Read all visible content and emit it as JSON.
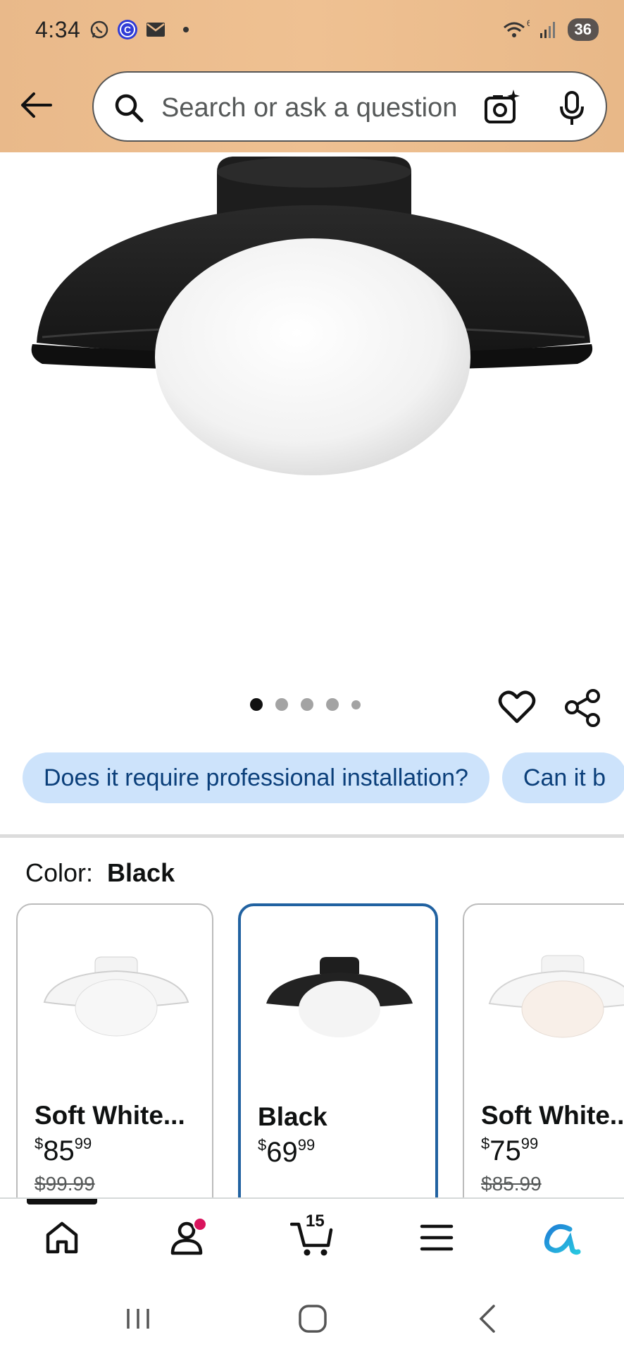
{
  "status_bar": {
    "time": "4:34",
    "wifi_label": "6",
    "battery": "36",
    "icons": [
      "whatsapp-icon",
      "c-app-icon",
      "mail-icon",
      "dot-icon",
      "wifi-icon",
      "signal-icon",
      "battery-icon"
    ]
  },
  "header": {
    "back_icon": "arrow-left-icon",
    "search_placeholder": "Search or ask a question",
    "camera_icon": "camera-sparkle-icon",
    "mic_icon": "microphone-icon",
    "accent_color": "#efc192"
  },
  "gallery": {
    "image_count": 5,
    "active_index": 0,
    "heart_icon": "heart-icon",
    "share_icon": "share-icon"
  },
  "questions": [
    "Does it require professional installation?",
    "Can it b"
  ],
  "color_selector": {
    "label": "Color:",
    "selected": "Black",
    "options": [
      {
        "name": "Soft White...",
        "price_whole": "85",
        "price_fraction": "99",
        "currency": "$",
        "list_price": "$99.99",
        "selected": false
      },
      {
        "name": "Black",
        "price_whole": "69",
        "price_fraction": "99",
        "currency": "$",
        "list_price": "",
        "selected": true
      },
      {
        "name": "Soft White...",
        "price_whole": "75",
        "price_fraction": "99",
        "currency": "$",
        "list_price": "$85.99",
        "selected": false
      }
    ]
  },
  "bottom_nav": {
    "cart_count": "15",
    "items": [
      "home-icon",
      "account-icon",
      "cart-icon",
      "menu-icon",
      "rufus-icon"
    ]
  },
  "colors": {
    "chip_bg": "#cde3fb",
    "chip_text": "#0b3f7a",
    "selected_border": "#2162a1",
    "badge": "#d9145d"
  }
}
